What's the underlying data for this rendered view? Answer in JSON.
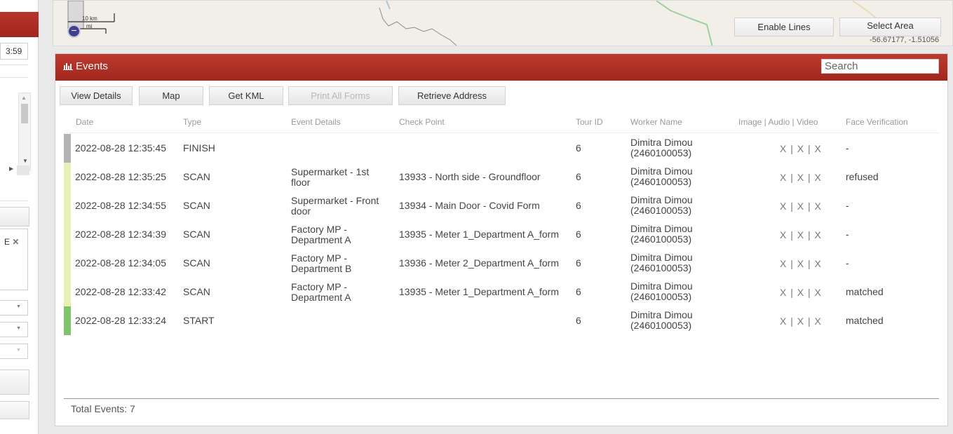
{
  "left_panel": {
    "time_fragment": "3:59",
    "tag_fragment": "E",
    "tag_remove_icon": "close-icon"
  },
  "map": {
    "scale_km": "10 km",
    "scale_mi": "mi",
    "zoom_out_label": "−",
    "enable_lines_label": "Enable Lines",
    "select_area_label": "Select Area",
    "coordinates": "-56.67177, -1.51056"
  },
  "events": {
    "title": "Events",
    "title_icon": "bar-chart-icon",
    "search_placeholder": "Search",
    "toolbar": {
      "view_details": "View Details",
      "map": "Map",
      "get_kml": "Get KML",
      "print_all_forms": "Print All Forms",
      "retrieve_address": "Retrieve Address"
    },
    "columns": {
      "date": "Date",
      "type": "Type",
      "event_details": "Event Details",
      "check_point": "Check Point",
      "tour_id": "Tour ID",
      "worker_name": "Worker Name",
      "media": "Image | Audio | Video",
      "face_verification": "Face Verification"
    },
    "rows": [
      {
        "status_color": "#b3b3b3",
        "date": "2022-08-28 12:35:45",
        "type": "FINISH",
        "details_1": "",
        "details_2": "",
        "check_point": "",
        "tour_id": "6",
        "worker_1": "Dimitra Dimou",
        "worker_2": "(2460100053)",
        "media": "X | X | X",
        "face": "-"
      },
      {
        "status_color": "#e7efb6",
        "date": "2022-08-28 12:35:25",
        "type": "SCAN",
        "details_1": "Supermarket - 1st",
        "details_2": "floor",
        "check_point": "13933 - North side - Groundfloor",
        "tour_id": "6",
        "worker_1": "Dimitra Dimou",
        "worker_2": "(2460100053)",
        "media": "X | X | X",
        "face": "refused"
      },
      {
        "status_color": "#e7efb6",
        "date": "2022-08-28 12:34:55",
        "type": "SCAN",
        "details_1": "Supermarket - Front",
        "details_2": "door",
        "check_point": "13934 - Main Door - Covid Form",
        "tour_id": "6",
        "worker_1": "Dimitra Dimou",
        "worker_2": "(2460100053)",
        "media": "X | X | X",
        "face": "-"
      },
      {
        "status_color": "#e7efb6",
        "date": "2022-08-28 12:34:39",
        "type": "SCAN",
        "details_1": "Factory MP -",
        "details_2": "Department A",
        "check_point": "13935 - Meter 1_Department A_form",
        "tour_id": "6",
        "worker_1": "Dimitra Dimou",
        "worker_2": "(2460100053)",
        "media": "X | X | X",
        "face": "-"
      },
      {
        "status_color": "#e7efb6",
        "date": "2022-08-28 12:34:05",
        "type": "SCAN",
        "details_1": "Factory MP -",
        "details_2": "Department B",
        "check_point": "13936 - Meter 2_Department A_form",
        "tour_id": "6",
        "worker_1": "Dimitra Dimou",
        "worker_2": "(2460100053)",
        "media": "X | X | X",
        "face": "-"
      },
      {
        "status_color": "#e7efb6",
        "date": "2022-08-28 12:33:42",
        "type": "SCAN",
        "details_1": "Factory MP -",
        "details_2": "Department A",
        "check_point": "13935 - Meter 1_Department A_form",
        "tour_id": "6",
        "worker_1": "Dimitra Dimou",
        "worker_2": "(2460100053)",
        "media": "X | X | X",
        "face": "matched"
      },
      {
        "status_color": "#7fc46a",
        "date": "2022-08-28 12:33:24",
        "type": "START",
        "details_1": "",
        "details_2": "",
        "check_point": "",
        "tour_id": "6",
        "worker_1": "Dimitra Dimou",
        "worker_2": "(2460100053)",
        "media": "X | X | X",
        "face": "matched"
      }
    ],
    "total_label": "Total Events: 7"
  }
}
